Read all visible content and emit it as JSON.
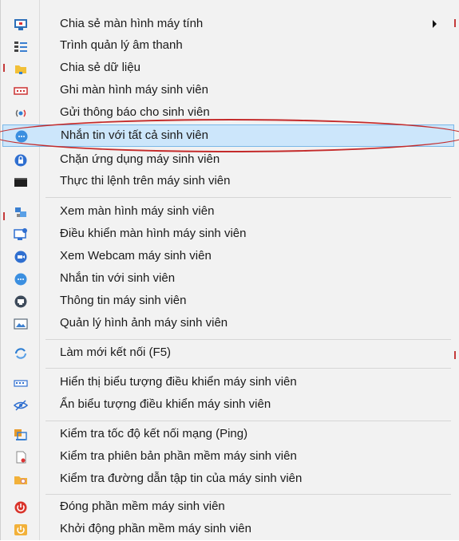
{
  "menu": {
    "items": [
      {
        "label": "Chia sẻ màn hình máy tính",
        "icon": "screen-share-icon",
        "submenu": true
      },
      {
        "label": "Trình quản lý âm thanh",
        "icon": "audio-manager-icon"
      },
      {
        "label": "Chia sẻ dữ liệu",
        "icon": "folder-share-icon"
      },
      {
        "label": "Ghi màn hình máy sinh viên",
        "icon": "screen-record-icon"
      },
      {
        "label": "Gửi thông báo cho sinh viên",
        "icon": "broadcast-icon"
      },
      {
        "label": "Nhắn tin với tất cả sinh viên",
        "icon": "chat-all-icon",
        "highlighted": true
      },
      {
        "label": "Chặn ứng dụng máy sinh viên",
        "icon": "lock-app-icon"
      },
      {
        "label": "Thực thi lệnh trên máy sinh viên",
        "icon": "terminal-icon"
      },
      {
        "label": "Xem màn hình máy sinh viên",
        "icon": "view-screen-icon"
      },
      {
        "label": "Điều khiển màn hình máy sinh viên",
        "icon": "remote-control-icon"
      },
      {
        "label": "Xem Webcam máy sinh viên",
        "icon": "webcam-icon"
      },
      {
        "label": "Nhắn tin với sinh viên",
        "icon": "chat-icon"
      },
      {
        "label": "Thông tin máy sinh viên",
        "icon": "computer-info-icon"
      },
      {
        "label": "Quản lý hình ảnh máy sinh viên",
        "icon": "image-manager-icon"
      },
      {
        "label": "Làm mới kết nối (F5)",
        "icon": "refresh-connection-icon"
      },
      {
        "label": "Hiển thị biểu tượng điều khiển máy sinh viên",
        "icon": "show-control-icon"
      },
      {
        "label": "Ẩn biểu tượng điều khiển máy sinh viên",
        "icon": "hide-control-icon"
      },
      {
        "label": "Kiểm tra tốc độ kết nối mạng (Ping)",
        "icon": "ping-icon"
      },
      {
        "label": "Kiểm tra phiên bản phần mềm máy sinh viên",
        "icon": "version-check-icon"
      },
      {
        "label": "Kiểm tra đường dẫn tập tin của máy sinh viên",
        "icon": "folder-path-icon"
      },
      {
        "label": "Đóng phần mềm máy sinh viên",
        "icon": "power-off-icon"
      },
      {
        "label": "Khởi động phần mềm máy sinh viên",
        "icon": "start-software-icon"
      }
    ]
  },
  "colors": {
    "highlight_bg": "#cce6fb",
    "highlight_border": "#7ab7e8",
    "annotation_red": "#c42b2b",
    "icon_blue": "#2f7fd3"
  }
}
